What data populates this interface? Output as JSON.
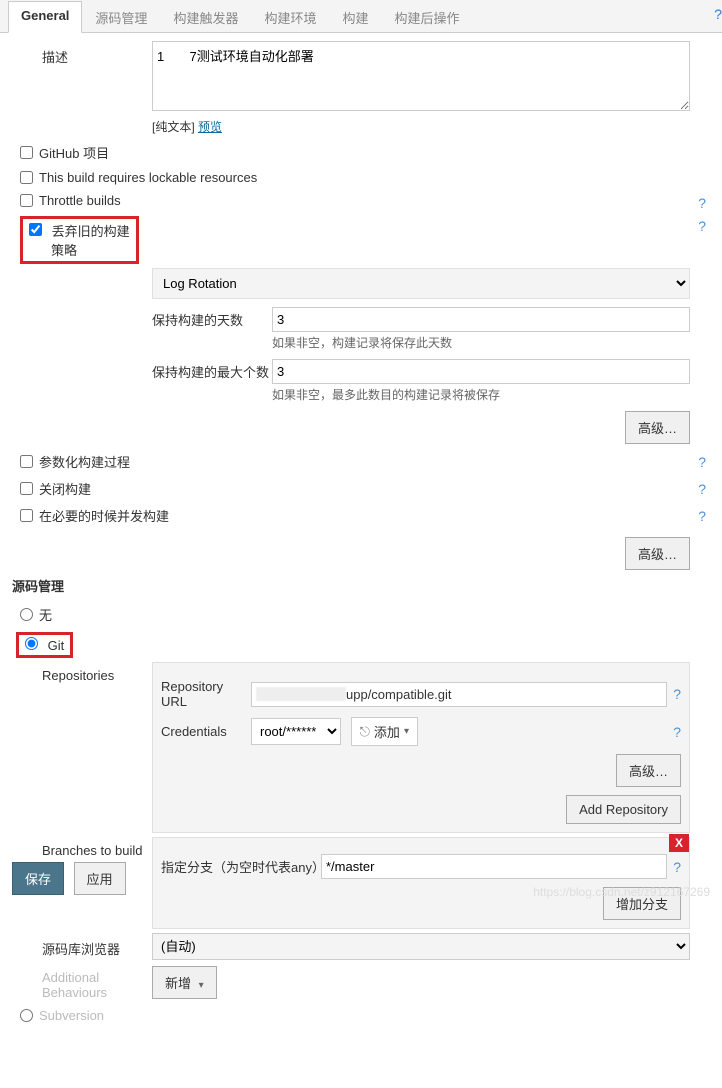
{
  "tabs": [
    "General",
    "源码管理",
    "构建触发器",
    "构建环境",
    "构建",
    "构建后操作"
  ],
  "desc_label": "描述",
  "desc_value": "1       7测试环境自动化部署",
  "plain_text": "[纯文本]",
  "preview": "预览",
  "opts": {
    "github_project": "GitHub 项目",
    "lockable": "This build requires lockable resources",
    "throttle": "Throttle builds",
    "discard_old": "丢弃旧的构建",
    "strategy_label": "策略",
    "strategy_value": "Log Rotation",
    "days_label": "保持构建的天数",
    "days_value": "3",
    "days_hint": "如果非空，构建记录将保存此天数",
    "max_label": "保持构建的最大个数",
    "max_value": "3",
    "max_hint": "如果非空，最多此数目的构建记录将被保存",
    "advanced": "高级…",
    "parameterized": "参数化构建过程",
    "disable_build": "关闭构建",
    "concurrent": "在必要的时候并发构建"
  },
  "scm": {
    "title": "源码管理",
    "none": "无",
    "git": "Git",
    "repositories": "Repositories",
    "repo_url_label": "Repository URL",
    "repo_url_suffix": "upp/compatible.git",
    "credentials_label": "Credentials",
    "credentials_value": "root/******",
    "add": "添加",
    "add_repository": "Add Repository",
    "branches_label": "Branches to build",
    "branch_spec_label": "指定分支（为空时代表any）",
    "branch_spec_value": "*/master",
    "add_branch": "增加分支",
    "browser_label": "源码库浏览器",
    "browser_value": "(自动)",
    "additional": "Additional Behaviours",
    "add_new": "新增",
    "subversion": "Subversion"
  },
  "footer": {
    "save": "保存",
    "apply": "应用"
  },
  "watermark": "https://blog.csdn.net/z912167269"
}
